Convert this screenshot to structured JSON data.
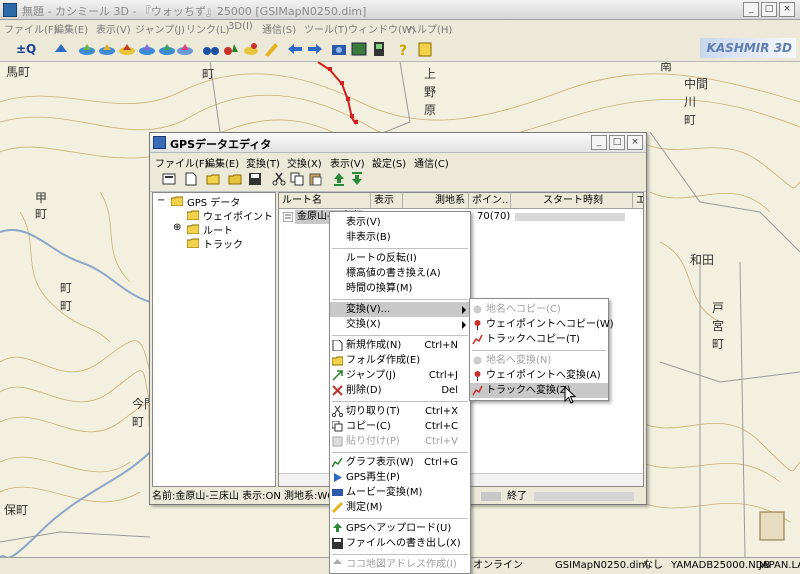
{
  "window": {
    "title": "無題 - カシミール 3D - 『ウォッちず』25000 [GSIMapN0250.dim]"
  },
  "menubar": [
    "ファイル(F)",
    "編集(E)",
    "表示(V)",
    "ジャンプ(J)",
    "リンク(L)",
    "3D(I)",
    "通信(S)",
    "ツール(T)",
    "ウィンドウ(W)",
    "ヘルプ(H)"
  ],
  "toolbar": {
    "logo": "KASHMIR 3D",
    "first_label": "±Q"
  },
  "map": {
    "labels": [
      "馬町",
      "町",
      "甲",
      "町",
      "上",
      "野",
      "原",
      "南",
      "中間",
      "川",
      "町",
      "町",
      "町",
      "和田",
      "戸",
      "宮",
      "町",
      "保町",
      "今門",
      "町"
    ]
  },
  "gps_editor": {
    "title": "GPSデータエディタ",
    "menu": [
      "ファイル(F)",
      "編集(E)",
      "変換(T)",
      "交換(X)",
      "表示(V)",
      "設定(S)",
      "通信(C)"
    ],
    "tree": {
      "root": "GPS データ",
      "children": [
        "ウェイポイント",
        "ルート",
        "トラック"
      ]
    },
    "columns": [
      "ルート名",
      "表示",
      "測地系",
      "ポイン..",
      "スタート時刻",
      "エ"
    ],
    "row": {
      "name": "金原山-三床山",
      "points": "70(70)"
    },
    "status_left": "名前:金原山-三床山 表示:ON 測地系:WGS84",
    "status_right": "終了"
  },
  "context_menu": {
    "items": [
      {
        "label": "表示(V)",
        "shortcut": "",
        "icon": ""
      },
      {
        "label": "非表示(B)",
        "shortcut": "",
        "icon": ""
      },
      {
        "label": "ルートの反転(I)",
        "shortcut": "",
        "icon": ""
      },
      {
        "label": "標高値の書き換え(A)",
        "shortcut": "",
        "icon": ""
      },
      {
        "label": "時間の換算(M)",
        "shortcut": "",
        "icon": ""
      },
      {
        "label": "変換(V)...",
        "shortcut": "",
        "icon": ""
      },
      {
        "label": "交換(X)",
        "shortcut": "",
        "icon": ""
      },
      {
        "label": "新規作成(N)",
        "shortcut": "Ctrl+N",
        "icon": "new-file-icon"
      },
      {
        "label": "フォルダ作成(E)",
        "shortcut": "",
        "icon": "folder-icon"
      },
      {
        "label": "ジャンプ(J)",
        "shortcut": "Ctrl+J",
        "icon": "jump-icon"
      },
      {
        "label": "削除(D)",
        "shortcut": "Del",
        "icon": "delete-icon"
      },
      {
        "label": "切り取り(T)",
        "shortcut": "Ctrl+X",
        "icon": "cut-icon"
      },
      {
        "label": "コピー(C)",
        "shortcut": "Ctrl+C",
        "icon": "copy-icon"
      },
      {
        "label": "貼り付け(P)",
        "shortcut": "Ctrl+V",
        "icon": "paste-icon"
      },
      {
        "label": "グラフ表示(W)",
        "shortcut": "Ctrl+G",
        "icon": "graph-icon"
      },
      {
        "label": "GPS再生(P)",
        "shortcut": "",
        "icon": "gps-play-icon"
      },
      {
        "label": "ムービー変換(M)",
        "shortcut": "",
        "icon": "movie-icon"
      },
      {
        "label": "測定(M)",
        "shortcut": "",
        "icon": "ruler-icon"
      },
      {
        "label": "GPSへアップロード(U)",
        "shortcut": "",
        "icon": "upload-icon"
      },
      {
        "label": "ファイルへの書き出し(X)",
        "shortcut": "",
        "icon": "save-icon"
      },
      {
        "label": "ココ地図アドレス作成(I)",
        "shortcut": "",
        "icon": "address-icon"
      }
    ]
  },
  "submenu": {
    "items": [
      {
        "label": "地名へコピー(C)"
      },
      {
        "label": "ウェイポイントへコピー(W)"
      },
      {
        "label": "トラックへコピー(T)"
      },
      {
        "label": "地名へ変換(N)"
      },
      {
        "label": "ウェイポイントへ変換(A)"
      },
      {
        "label": "トラックへ変換(Z)"
      }
    ]
  },
  "statusbar": {
    "status": "オンライン",
    "file": "GSIMapN0250.dim",
    "none": "なし",
    "db": "YAMADB25000.NDB",
    "region": "JAPAN.LAK"
  },
  "colors": {
    "route": "#d31f1f",
    "highlight": "#c8c8c8",
    "map_bg": "#f3f0df",
    "contour": "#c9a86a"
  }
}
